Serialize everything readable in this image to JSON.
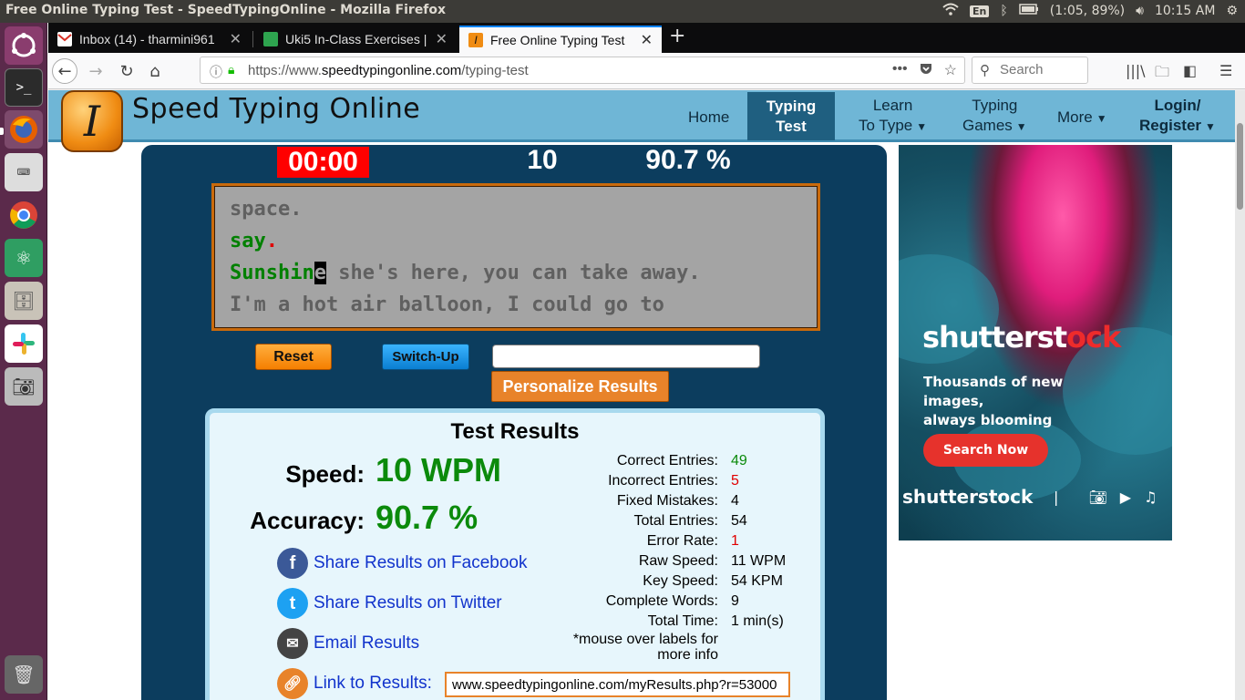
{
  "os": {
    "window_title": "Free Online Typing Test - SpeedTypingOnline - Mozilla Firefox",
    "lang": "En",
    "battery": "(1:05, 89%)",
    "clock": "10:15 AM"
  },
  "browser": {
    "tabs": [
      {
        "label": "Inbox (14) - tharmini961"
      },
      {
        "label": "Uki5 In-Class Exercises |"
      },
      {
        "label": "Free Online Typing Test"
      }
    ],
    "url_prefix": "https://www.",
    "url_host": "speedtypingonline.com",
    "url_path": "/typing-test",
    "search_placeholder": "Search"
  },
  "site": {
    "name": "Speed Typing Online",
    "logo_letter": "I",
    "menu": {
      "home": "Home",
      "typing_test_1": "Typing",
      "typing_test_2": "Test",
      "learn_1": "Learn",
      "learn_2": "To Type",
      "games_1": "Typing",
      "games_2": "Games",
      "more": "More",
      "login_1": "Login/",
      "login_2": "Register"
    }
  },
  "test": {
    "timer": "00:00",
    "wpm": "10",
    "accuracy": "90.7 %",
    "lines": {
      "l1": "space.",
      "l2_ok": "say",
      "l2_bad": ".",
      "l3_ok": "Sunshin",
      "l3_cursor": "e",
      "l3_rest": " she's here, you can take away.",
      "l4": "I'm a hot air balloon, I could go to"
    },
    "reset_label": "Reset",
    "switch_label": "Switch-Up",
    "name_value": "",
    "personalize_label": "Personalize Results"
  },
  "results": {
    "title": "Test Results",
    "speed_label": "Speed:",
    "speed_value": "10 WPM",
    "accuracy_label": "Accuracy:",
    "accuracy_value": "90.7 %",
    "share_facebook": "Share Results on Facebook",
    "share_twitter": "Share Results on Twitter",
    "email": "Email Results",
    "link_label": "Link to Results:",
    "link_value": "www.speedtypingonline.com/myResults.php?r=53000",
    "stats": {
      "correct_label": "Correct Entries:",
      "correct": "49",
      "incorrect_label": "Incorrect Entries:",
      "incorrect": "5",
      "fixed_label": "Fixed Mistakes:",
      "fixed": "4",
      "total_label": "Total Entries:",
      "total": "54",
      "error_label": "Error Rate:",
      "error": "1",
      "raw_label": "Raw Speed:",
      "raw": "11 WPM",
      "key_label": "Key Speed:",
      "key": "54 KPM",
      "words_label": "Complete Words:",
      "words": "9",
      "time_label": "Total Time:",
      "time": "1 min(s)",
      "note_1": "*mouse over labels for",
      "note_2": "more info"
    }
  },
  "ad": {
    "brand_a": "shutterst",
    "brand_b": "o",
    "brand_c": "ck",
    "tagline_1": "Thousands of new images,",
    "tagline_2": "always blooming",
    "cta": "Search Now",
    "footer_brand": "shutterstock"
  },
  "colors": {
    "header_blue": "#6fb6d6",
    "panel_navy": "#0c3d5e",
    "timer_red": "#ff0000",
    "result_green": "#0b8a0b",
    "link_blue": "#1133cc"
  }
}
